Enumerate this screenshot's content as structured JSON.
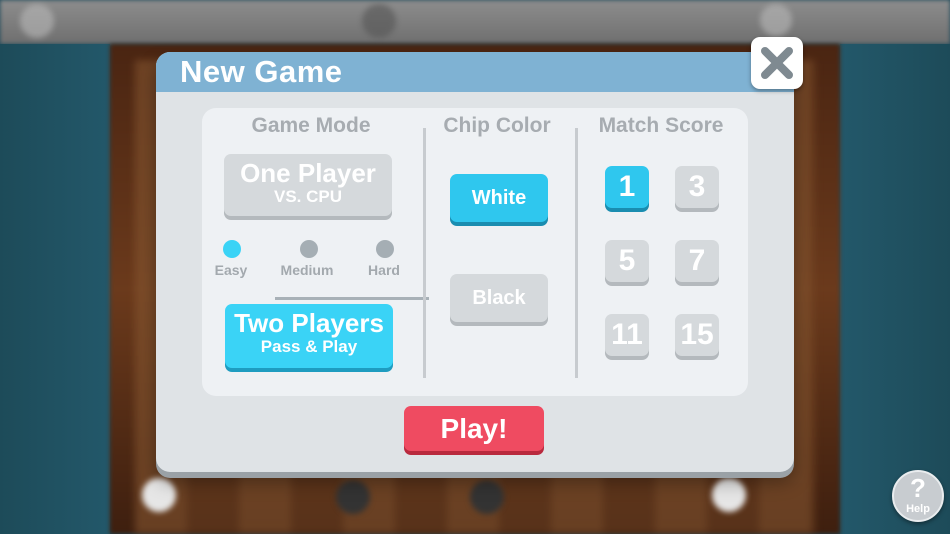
{
  "dialog": {
    "title": "New Game",
    "close_icon": "close-x-icon"
  },
  "game_mode": {
    "heading": "Game Mode",
    "one_player": {
      "title": "One Player",
      "subtitle": "VS. CPU",
      "selected": false
    },
    "difficulty": {
      "options": [
        "Easy",
        "Medium",
        "Hard"
      ],
      "selected": "Easy"
    },
    "two_players": {
      "title": "Two Players",
      "subtitle": "Pass & Play",
      "selected": true
    }
  },
  "chip_color": {
    "heading": "Chip Color",
    "options": [
      "White",
      "Black"
    ],
    "selected": "White"
  },
  "match_score": {
    "heading": "Match Score",
    "options": [
      "1",
      "3",
      "5",
      "7",
      "11",
      "15"
    ],
    "selected": "1"
  },
  "play_button": {
    "label": "Play!"
  },
  "help_button": {
    "icon": "question-mark-icon",
    "label": "Help"
  },
  "colors": {
    "header_blue": "#7fb2d3",
    "selected_cyan": "#3ad3f6",
    "play_red": "#ef4b61",
    "unselected_grey": "#d5d9dc"
  }
}
